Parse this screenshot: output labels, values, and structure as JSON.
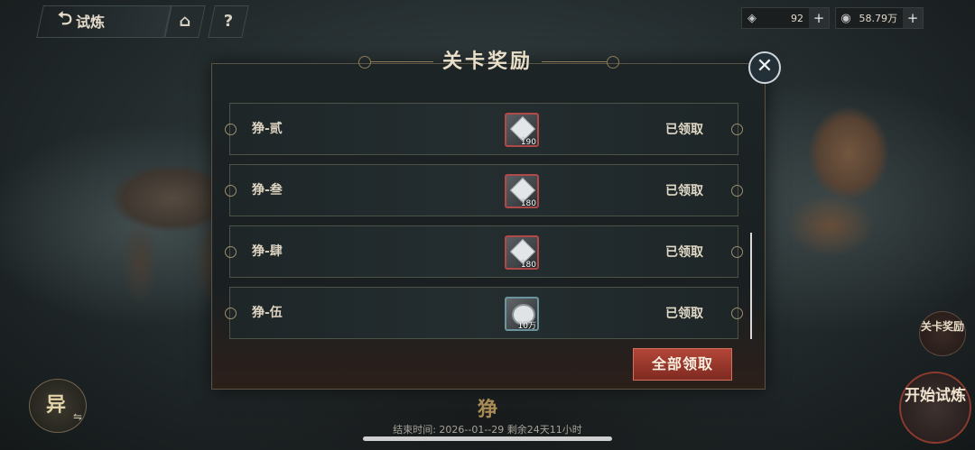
{
  "nav": {
    "back_label": "试炼",
    "home_icon": "home-icon",
    "help_label": "?"
  },
  "currencies": [
    {
      "name": "gem",
      "icon": "diamond-icon",
      "value": "92"
    },
    {
      "name": "silver",
      "icon": "coin-icon",
      "value": "58.79万"
    }
  ],
  "panel": {
    "title": "关卡奖励",
    "rows": [
      {
        "stage": "狰-贰",
        "item": "crystal",
        "qty": "190",
        "status": "已领取"
      },
      {
        "stage": "狰-叁",
        "item": "crystal",
        "qty": "180",
        "status": "已领取"
      },
      {
        "stage": "狰-肆",
        "item": "crystal",
        "qty": "180",
        "status": "已领取"
      },
      {
        "stage": "狰-伍",
        "item": "silver",
        "qty": "10万",
        "status": "已领取"
      }
    ],
    "claim_all_label": "全部领取"
  },
  "side": {
    "reward_label": "关卡奖励",
    "start_label": "开始试炼",
    "switch_char": "异",
    "switch_icon": "swap-icon"
  },
  "bottom": {
    "mode_name": "狰",
    "end_time_text": "结束时间: 2026--01--29  剩余24天11小时"
  },
  "colors": {
    "claim_button": "#b34638",
    "item_border_rare": "#b34848",
    "item_border_silver": "#6a95a0"
  }
}
